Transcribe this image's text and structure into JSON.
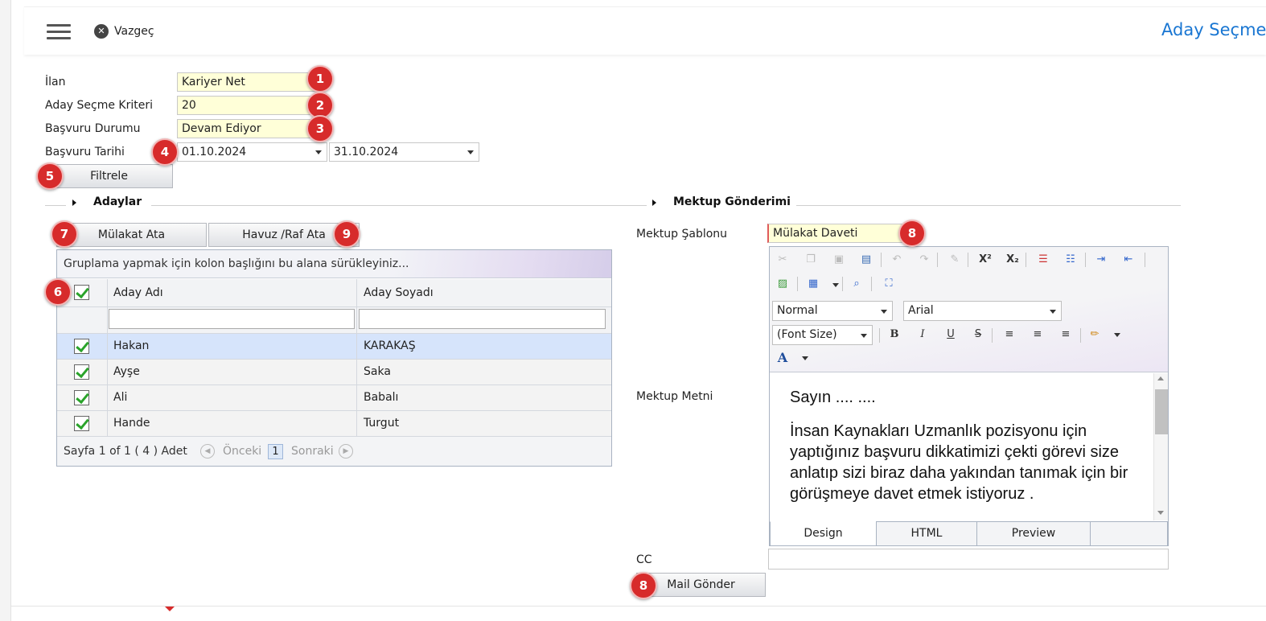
{
  "header": {
    "cancel_label": "Vazgeç",
    "page_title": "Aday Seçme"
  },
  "filters": {
    "ilan_label": "İlan",
    "ilan_value": "Kariyer Net",
    "kriter_label": "Aday Seçme Kriteri",
    "kriter_value": "20",
    "durum_label": "Başvuru Durumu",
    "durum_value": "Devam Ediyor",
    "tarih_label": "Başvuru Tarihi",
    "tarih_start": "01.10.2024",
    "tarih_end": "31.10.2024",
    "filter_button": "Filtrele"
  },
  "badges": [
    "1",
    "2",
    "3",
    "4",
    "5",
    "6",
    "7",
    "8",
    "9"
  ],
  "candidates": {
    "section_title": "Adaylar",
    "interview_button": "Mülakat Ata",
    "pool_button": "Havuz /Raf Ata",
    "group_hint": "Gruplama yapmak için kolon başlığını bu alana sürükleyiniz...",
    "columns": [
      "Aday Adı",
      "Aday Soyadı"
    ],
    "rows": [
      {
        "name": "Hakan",
        "surname": "KARAKAŞ"
      },
      {
        "name": "Ayşe",
        "surname": "Saka"
      },
      {
        "name": "Ali",
        "surname": "Babalı"
      },
      {
        "name": "Hande",
        "surname": "Turgut"
      }
    ],
    "pager": {
      "summary": "Sayfa 1 of 1 ( 4 ) Adet",
      "prev": "Önceki",
      "page": "1",
      "next": "Sonraki"
    }
  },
  "letter": {
    "section_title": "Mektup Gönderimi",
    "template_label": "Mektup Şablonu",
    "template_value": "Mülakat Daveti",
    "body_label": "Mektup Metni",
    "format_select": "Normal",
    "font_select": "Arial",
    "size_select": "(Font Size)",
    "greeting": "Sayın .... ....",
    "body_text": "İnsan Kaynakları Uzmanlık pozisyonu için yaptığınız başvuru dikkatimizi çekti görevi size anlatıp sizi biraz daha yakından tanımak için bir görüşmeye davet etmek istiyoruz .",
    "tabs": [
      "Design",
      "HTML",
      "Preview"
    ],
    "cc_label": "CC",
    "cc_value": "",
    "send_button": "Mail Gönder"
  },
  "colors": {
    "title_blue": "#1976d2",
    "badge_red": "#d72b2b",
    "highlight_row": "#d6e4fb",
    "field_yellow": "#ffffd8"
  }
}
